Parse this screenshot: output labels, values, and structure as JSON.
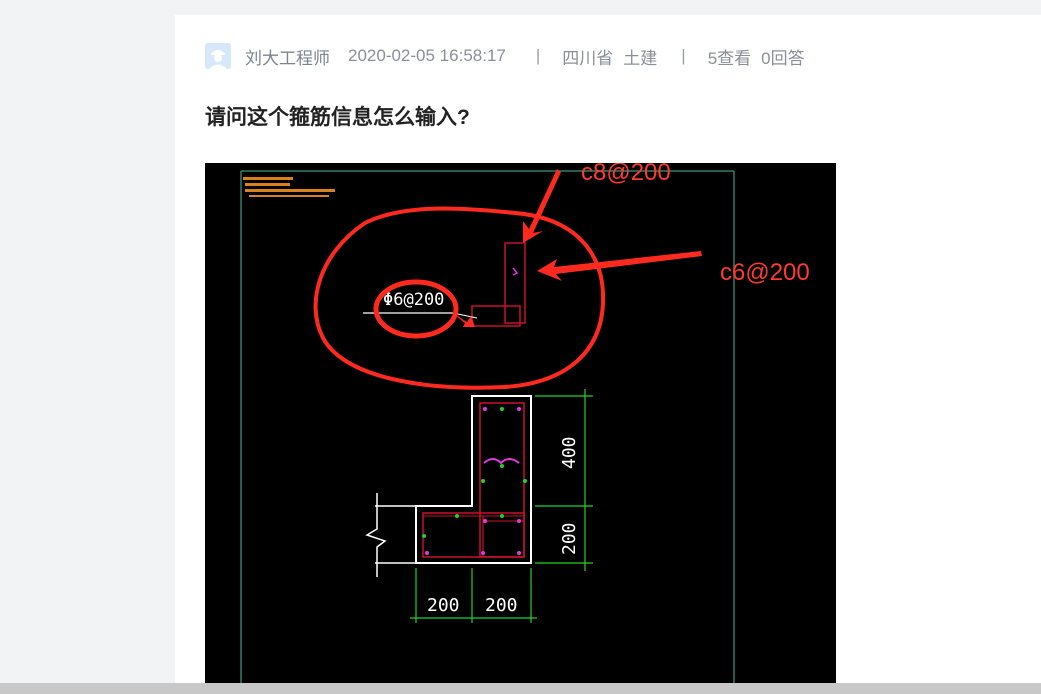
{
  "post": {
    "author": "刘大工程师",
    "time": "2020-02-05 16:58:17",
    "separator": "|",
    "region": "四川省",
    "category": "土建",
    "views": "5查看",
    "answers": "0回答",
    "title": "请问这个箍筋信息怎么输入?"
  },
  "drawing": {
    "label_stirrup": "Φ6@200",
    "dim_400": "400",
    "dim_200_v": "200",
    "dim_200_a": "200",
    "dim_200_b": "200",
    "annotation_c8": "c8@200",
    "annotation_c6": "c6@200"
  },
  "colors": {
    "annotation_red": "#ff3a2e",
    "cad_green": "#22d322",
    "cad_magenta": "#e03adf",
    "rebar_red": "#c8102e"
  }
}
